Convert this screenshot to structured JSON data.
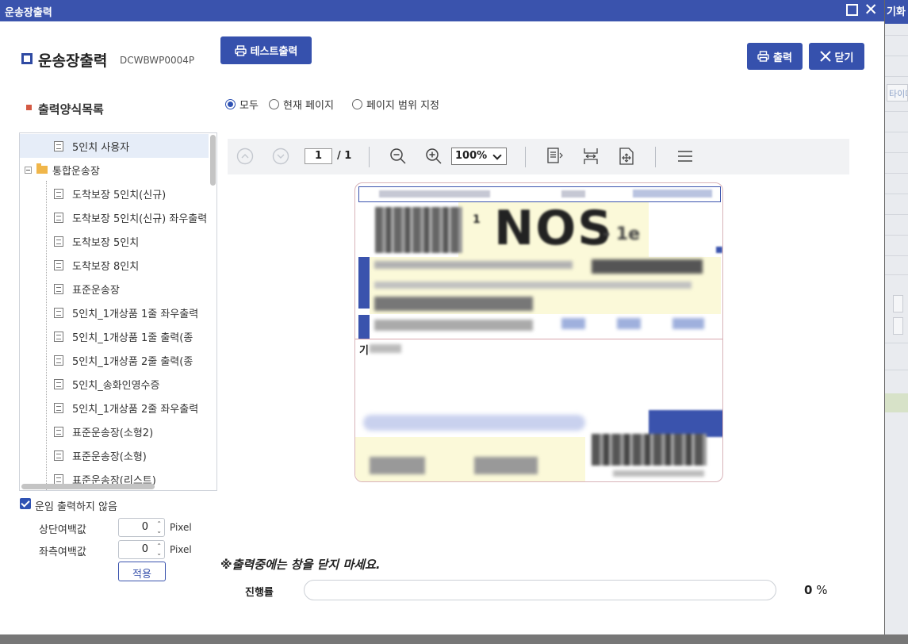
{
  "background": {
    "title": "기화",
    "field_text": "타이머"
  },
  "window": {
    "title": "운송장출력"
  },
  "header": {
    "title": "운송장출력",
    "code": "DCWBWP0004P"
  },
  "buttons": {
    "test_print": "테스트출력",
    "print": "출력",
    "close": "닫기"
  },
  "form_list": {
    "title": "출력양식목록",
    "items": [
      {
        "label": "5인치 사용자",
        "type": "doc",
        "selected": true
      },
      {
        "label": "통합운송장",
        "type": "folder"
      },
      {
        "label": "도착보장 5인치(신규)",
        "type": "doc"
      },
      {
        "label": "도착보장 5인치(신규) 좌우출력",
        "type": "doc"
      },
      {
        "label": "도착보장 5인치",
        "type": "doc"
      },
      {
        "label": "도착보장 8인치",
        "type": "doc"
      },
      {
        "label": "표준운송장",
        "type": "doc"
      },
      {
        "label": "5인치_1개상품 1줄 좌우출력",
        "type": "doc"
      },
      {
        "label": "5인치_1개상품 1줄 출력(종",
        "type": "doc"
      },
      {
        "label": "5인치_1개상품 2줄 출력(종",
        "type": "doc"
      },
      {
        "label": "5인치_송화인영수증",
        "type": "doc"
      },
      {
        "label": "5인치_1개상품 2줄 좌우출력",
        "type": "doc"
      },
      {
        "label": "표준운송장(소형2)",
        "type": "doc"
      },
      {
        "label": "표준운송장(소형)",
        "type": "doc"
      },
      {
        "label": "표준운송장(리스트)",
        "type": "doc"
      }
    ]
  },
  "options": {
    "no_fare_print": {
      "label": "운임 출력하지 않음",
      "checked": true
    },
    "top_margin": {
      "label": "상단여백값",
      "value": "0",
      "unit": "Pixel"
    },
    "left_margin": {
      "label": "좌측여백값",
      "value": "0",
      "unit": "Pixel"
    },
    "apply": "적용"
  },
  "page_range": {
    "options": [
      "모두",
      "현재 페이지",
      "페이지 범위 지정"
    ],
    "selected": 0
  },
  "viewer": {
    "current_page": "1",
    "total_pages": "/ 1",
    "zoom": "100%",
    "icons": [
      "page-up-icon",
      "page-down-icon",
      "zoom-out-icon",
      "zoom-in-icon",
      "fit-page-icon",
      "fit-width-icon",
      "fit-actual-icon",
      "menu-icon"
    ]
  },
  "preview": {
    "big_text": "NOS",
    "prefix": "1",
    "suffix": "- 1e",
    "mid_label": "기"
  },
  "progress": {
    "warning": "※출력중에는 창을 닫지 마세요.",
    "label": "진행률",
    "value": "0",
    "unit": "%",
    "fraction": 0
  },
  "colors": {
    "accent": "#3a53ad",
    "label_yellow": "#fbf9d9"
  }
}
